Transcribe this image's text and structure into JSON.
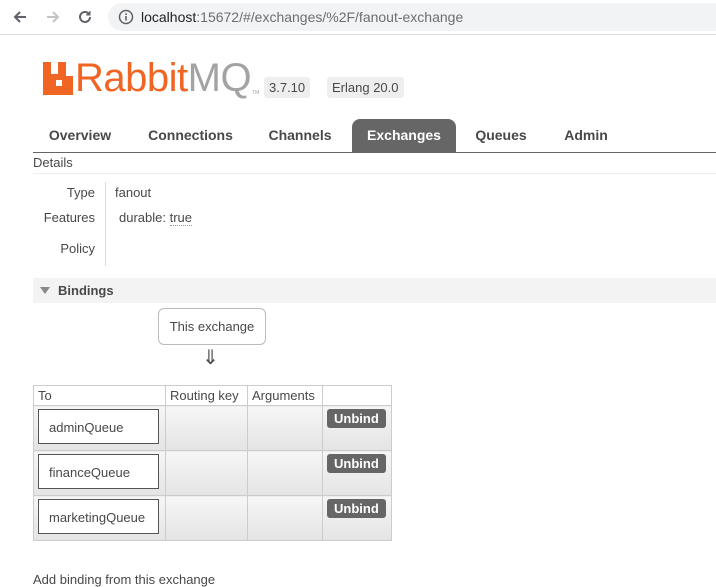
{
  "browser": {
    "url_host": "localhost",
    "url_rest": ":15672/#/exchanges/%2F/fanout-exchange"
  },
  "header": {
    "logo_rabbit": "Rabbit",
    "logo_mq": "MQ",
    "logo_tm": "TM",
    "version": "3.7.10",
    "erlang": "Erlang 20.0"
  },
  "tabs": [
    {
      "label": "Overview"
    },
    {
      "label": "Connections"
    },
    {
      "label": "Channels"
    },
    {
      "label": "Exchanges",
      "active": true
    },
    {
      "label": "Queues"
    },
    {
      "label": "Admin"
    }
  ],
  "details": {
    "title": "Details",
    "type_label": "Type",
    "type_value": "fanout",
    "features_label": "Features",
    "feature_key": "durable:",
    "feature_value": "true",
    "policy_label": "Policy"
  },
  "bindings": {
    "title": "Bindings",
    "this_exchange": "This exchange",
    "arrow": "⇓",
    "columns": [
      "To",
      "Routing key",
      "Arguments",
      ""
    ],
    "rows": [
      {
        "to": "adminQueue",
        "routing_key": "",
        "arguments": "",
        "action": "Unbind"
      },
      {
        "to": "financeQueue",
        "routing_key": "",
        "arguments": "",
        "action": "Unbind"
      },
      {
        "to": "marketingQueue",
        "routing_key": "",
        "arguments": "",
        "action": "Unbind"
      }
    ]
  },
  "footer_cut_text": "Add binding from this exchange",
  "colors": {
    "brand_orange": "#f06424",
    "logo_grey": "#a3a3a3",
    "active_tab": "#666666"
  }
}
